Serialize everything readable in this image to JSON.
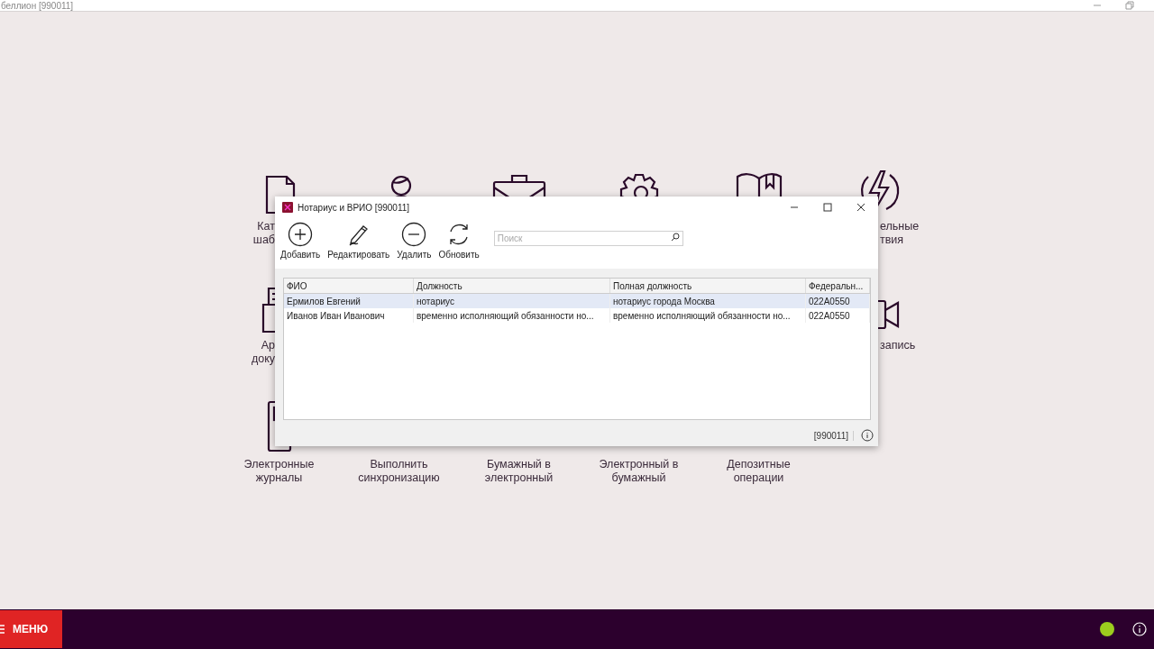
{
  "app_window": {
    "title": "беллион [990011]"
  },
  "tile_labels": [
    "Кат шаб",
    "ельные твия",
    "Ар доку",
    "запись",
    "Электронные журналы",
    "Выполнить синхронизацию",
    "Бумажный в электронный",
    "Электронный в бумажный",
    "Депозитные операции"
  ],
  "dialog": {
    "title": "Нотариус и ВРИО [990011]",
    "toolbar": [
      {
        "kind": "add",
        "label": "Добавить"
      },
      {
        "kind": "edit",
        "label": "Редактировать"
      },
      {
        "kind": "remove",
        "label": "Удалить"
      },
      {
        "kind": "refresh",
        "label": "Обновить"
      }
    ],
    "search": {
      "placeholder": "Поиск"
    },
    "table": {
      "columns": [
        "ФИО",
        "Должность",
        "Полная должность",
        "Федеральн..."
      ],
      "rows": [
        {
          "selected": true,
          "cells": [
            "Ермилов Евгений",
            "нотариус",
            "нотариус города Москва",
            "022A0550"
          ]
        },
        {
          "selected": false,
          "cells": [
            "Иванов Иван Иванович",
            "временно исполняющий обязанности но...",
            "временно исполняющий обязанности но...",
            "022A0550"
          ]
        }
      ]
    },
    "status": "[990011]"
  },
  "taskbar": {
    "menu_label": "МЕНЮ",
    "status_on": true
  }
}
